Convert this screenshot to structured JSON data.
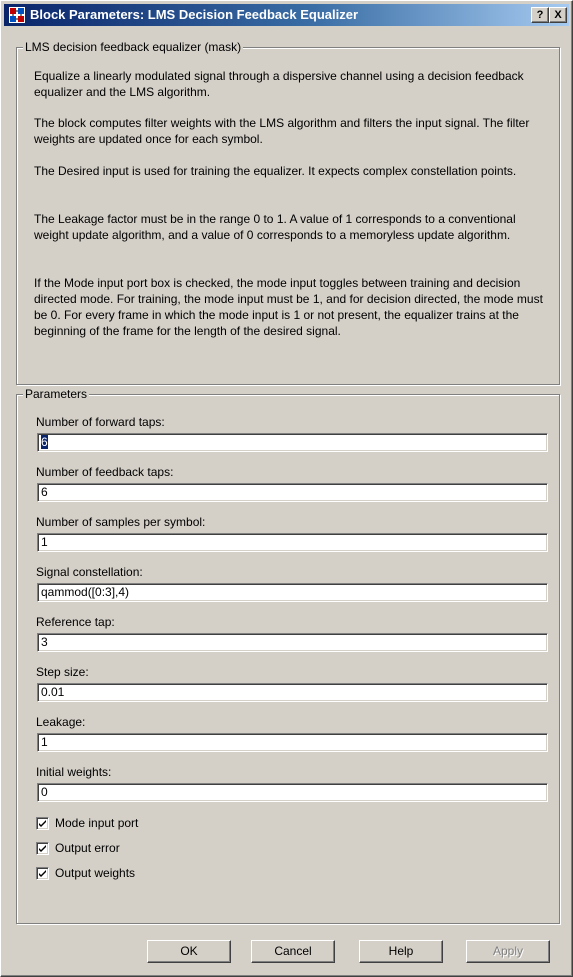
{
  "window": {
    "title": "Block Parameters: LMS Decision  Feedback Equalizer",
    "help_glyph": "?",
    "close_glyph": "X"
  },
  "description": {
    "legend": "LMS decision feedback equalizer (mask)",
    "paragraphs": [
      "Equalize a linearly modulated signal through a dispersive channel using a decision feedback equalizer and the LMS algorithm.",
      "The block computes filter weights with the LMS algorithm and filters the input signal. The filter weights are updated once for each symbol.",
      "The Desired input is used for training the equalizer. It expects complex constellation points.",
      "The Leakage factor must be in the range 0 to 1.  A value of 1 corresponds to a conventional weight update algorithm, and a value of 0 corresponds to a memoryless update algorithm.",
      "If the Mode input port box is checked, the mode input toggles between training and decision directed mode. For training, the mode input must be 1, and for decision directed, the mode must be 0. For every frame in which the mode input is 1 or not present, the equalizer trains at the beginning of the frame for the length of the desired signal."
    ]
  },
  "parameters": {
    "legend": "Parameters",
    "fields": [
      {
        "label": "Number of forward taps:",
        "value": "6"
      },
      {
        "label": "Number of feedback taps:",
        "value": "6"
      },
      {
        "label": "Number of samples per symbol:",
        "value": "1"
      },
      {
        "label": "Signal constellation:",
        "value": "qammod([0:3],4)"
      },
      {
        "label": "Reference tap:",
        "value": "3"
      },
      {
        "label": "Step size:",
        "value": "0.01"
      },
      {
        "label": "Leakage:",
        "value": "1"
      },
      {
        "label": "Initial weights:",
        "value": "0"
      }
    ],
    "checkboxes": [
      {
        "label": "Mode input port",
        "checked": true
      },
      {
        "label": "Output error",
        "checked": true
      },
      {
        "label": "Output weights",
        "checked": true
      }
    ]
  },
  "buttons": {
    "ok": "OK",
    "cancel": "Cancel",
    "help": "Help",
    "apply": "Apply"
  },
  "colors": {
    "dialog_face": "#d4d0c8",
    "titlebar_start": "#0a246a",
    "titlebar_end": "#a6caf0",
    "selection": "#0a246a"
  }
}
